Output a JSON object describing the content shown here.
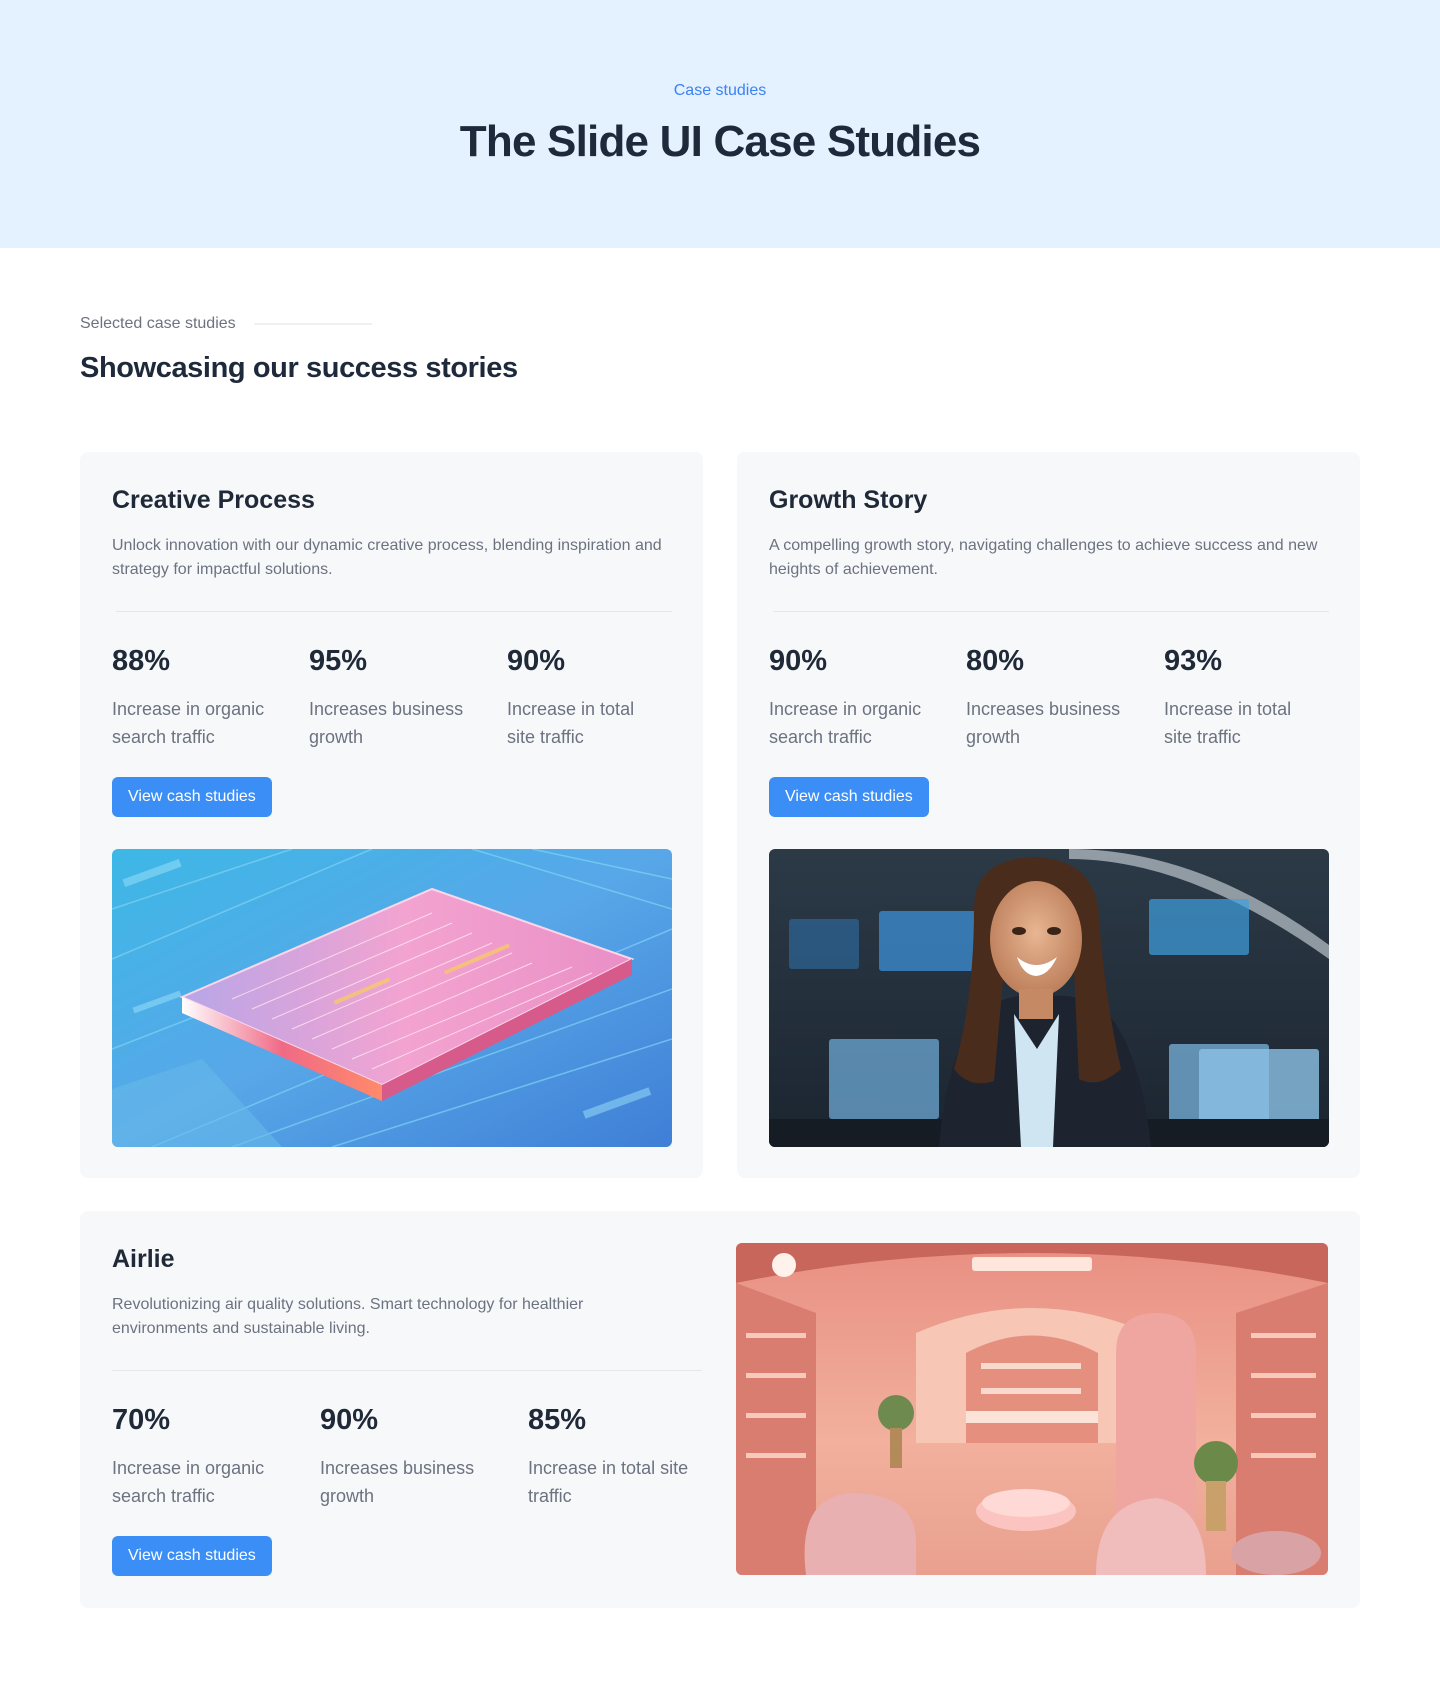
{
  "hero": {
    "eyebrow": "Case studies",
    "title": "The Slide UI Case Studies"
  },
  "section": {
    "eyebrow": "Selected case studies",
    "title": "Showcasing our success stories"
  },
  "cards": [
    {
      "title": "Creative Process",
      "description": "Unlock innovation with our dynamic creative process, blending inspiration and strategy for impactful solutions.",
      "stats": [
        {
          "value": "88%",
          "label": "Increase in organic search traffic"
        },
        {
          "value": "95%",
          "label": "Increases business growth"
        },
        {
          "value": "90%",
          "label": "Increase in total site traffic"
        }
      ],
      "button_label": "View cash studies",
      "image": "microchip-circuit-illustration"
    },
    {
      "title": "Growth Story",
      "description": "A compelling growth story, navigating challenges to achieve success and new heights of achievement.",
      "stats": [
        {
          "value": "90%",
          "label": "Increase in organic search traffic"
        },
        {
          "value": "80%",
          "label": "Increases business growth"
        },
        {
          "value": "93%",
          "label": "Increase in total site traffic"
        }
      ],
      "button_label": "View cash studies",
      "image": "smiling-businesswoman-in-office"
    },
    {
      "title": "Airlie",
      "description": "Revolutionizing air quality solutions. Smart technology for healthier environments and sustainable living.",
      "stats": [
        {
          "value": "70%",
          "label": "Increase in organic search traffic"
        },
        {
          "value": "90%",
          "label": "Increases business growth"
        },
        {
          "value": "85%",
          "label": "Increase in total site traffic"
        }
      ],
      "button_label": "View cash studies",
      "image": "pink-boutique-interior"
    }
  ],
  "colors": {
    "accent": "#3b8ef5",
    "hero_background": "#e4f1ff",
    "card_background": "#f7f8fa",
    "heading": "#1e293b",
    "muted_text": "#6b7280"
  }
}
